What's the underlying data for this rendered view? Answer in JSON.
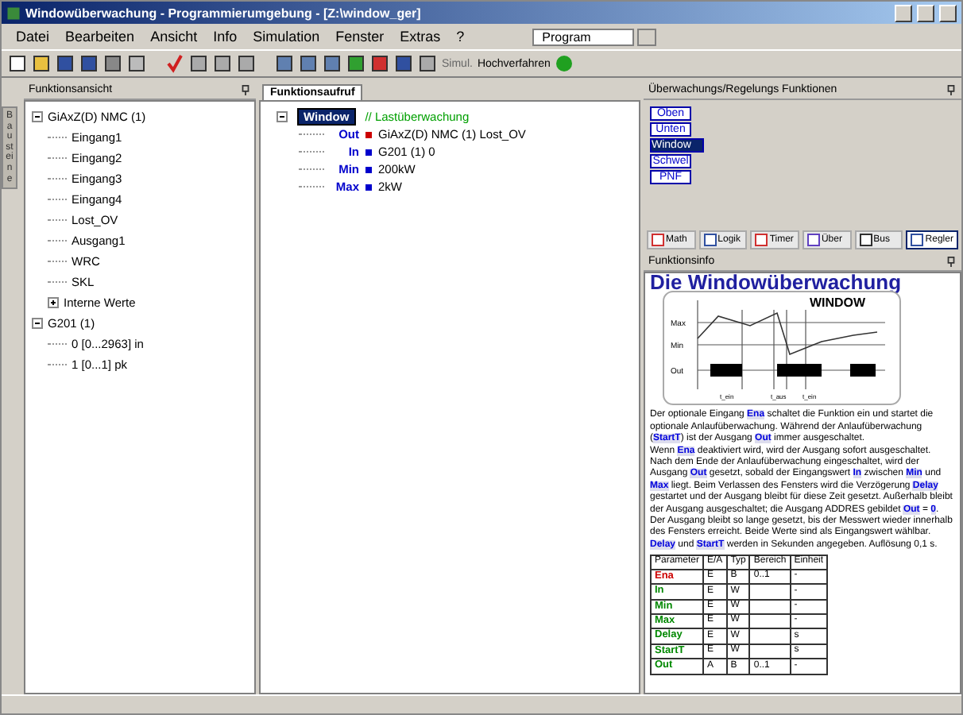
{
  "window": {
    "title": "Windowüberwachung - Programmierumgebung - [Z:\\window_ger]"
  },
  "menu": [
    "Datei",
    "Bearbeiten",
    "Ansicht",
    "Info",
    "Simulation",
    "Fenster",
    "Extras",
    "?"
  ],
  "program_select": {
    "value": "Program"
  },
  "toolbar": {
    "label_1": "Simul.",
    "label_2": "Hochverfahren"
  },
  "left_panel": {
    "side_tab": "Bausteine",
    "title": "Funktionsansicht",
    "tree": [
      {
        "label": "GiAxZ(D) NMC (1)",
        "expanded": true,
        "children": [
          {
            "label": "Eingang1"
          },
          {
            "label": "Eingang2"
          },
          {
            "label": "Eingang3"
          },
          {
            "label": "Eingang4"
          },
          {
            "label": "Lost_OV"
          },
          {
            "label": "Ausgang1"
          },
          {
            "label": "WRC"
          },
          {
            "label": "SKL"
          },
          {
            "label": "Interne Werte",
            "expanded": false
          }
        ]
      },
      {
        "label": "G201 (1)",
        "expanded": true,
        "children": [
          {
            "label": "0    [0...2963] in"
          },
          {
            "label": "1    [0...1] pk"
          }
        ]
      }
    ]
  },
  "code_panel": {
    "tab": "Funktionsaufruf",
    "block": "Window",
    "comment": "// Lastüberwachung",
    "params": [
      {
        "name": "Out",
        "value": "GiAxZ(D) NMC (1) Lost_OV",
        "color": "#cc0000"
      },
      {
        "name": "In",
        "value": "G201 (1) 0",
        "color": "#0000cc"
      },
      {
        "name": "Min",
        "value": "200kW",
        "color": "#0000cc"
      },
      {
        "name": "Max",
        "value": "2kW",
        "color": "#0000cc"
      }
    ]
  },
  "functions_panel": {
    "title": "Überwachungs/Regelungs Funktionen",
    "items": [
      {
        "label": "Oben",
        "selected": false
      },
      {
        "label": "Unten",
        "selected": false
      },
      {
        "label": "Window",
        "selected": true
      },
      {
        "label": "Schwel",
        "selected": false
      },
      {
        "label": "PNF",
        "selected": false
      }
    ],
    "tabs": [
      {
        "label": "Math",
        "selected": false
      },
      {
        "label": "Logik",
        "selected": false
      },
      {
        "label": "Timer",
        "selected": false
      },
      {
        "label": "Über",
        "selected": false
      },
      {
        "label": "Bus",
        "selected": false
      },
      {
        "label": "Regler",
        "selected": true
      }
    ]
  },
  "info_panel": {
    "title": "Funktionsinfo",
    "heading": "Die Windowüberwachung",
    "diagram": {
      "title": "WINDOW",
      "max": "Max",
      "min": "Min",
      "out": "Out",
      "t1": "t_ein",
      "t2": "t_aus",
      "t3": "t_ein"
    },
    "paragraphs": [
      "Der optionale Eingang **Ena** schaltet die Funktion ein und startet die optionale Anlaufüberwachung. Während der Anlaufüberwachung (**StartT**) ist der Ausgang **Out** immer ausgeschaltet.",
      "Wenn **Ena** deaktiviert wird, wird der Ausgang sofort ausgeschaltet. Nach dem Ende der Anlaufüberwachung eingeschaltet, wird der Ausgang **Out** gesetzt, sobald der Eingangswert **In** zwischen **Min** und **Max** liegt. Beim Verlassen des Fensters wird die Verzögerung **Delay** gestartet und der Ausgang bleibt für diese Zeit gesetzt. Außerhalb bleibt der Ausgang ausgeschaltet; die Ausgang ADDRES gebildet **Out** = **0**.",
      "Der Ausgang bleibt so lange gesetzt, bis der Messwert wieder innerhalb des Fensters erreicht. Beide Werte sind als Eingangswert wählbar. **Delay** und **StartT** werden in Sekunden angegeben. Auflösung 0,1 s."
    ],
    "table": {
      "columns": [
        "Parameter",
        "E/A",
        "Typ",
        "Bereich",
        "Einheit"
      ],
      "rows": [
        {
          "cells": [
            "Ena",
            "E",
            "B",
            "0..1",
            "-"
          ],
          "color": "#cc0000"
        },
        {
          "cells": [
            "In",
            "E",
            "W",
            "",
            "-"
          ],
          "color": "#008800"
        },
        {
          "cells": [
            "Min",
            "E",
            "W",
            "",
            "-"
          ],
          "color": "#008800"
        },
        {
          "cells": [
            "Max",
            "E",
            "W",
            "",
            "-"
          ],
          "color": "#008800"
        },
        {
          "cells": [
            "Delay",
            "E",
            "W",
            "",
            "s"
          ],
          "color": "#008800"
        },
        {
          "cells": [
            "StartT",
            "E",
            "W",
            "",
            "s"
          ],
          "color": "#008800"
        },
        {
          "cells": [
            "Out",
            "A",
            "B",
            "0..1",
            "-"
          ],
          "color": "#008800"
        }
      ]
    }
  }
}
